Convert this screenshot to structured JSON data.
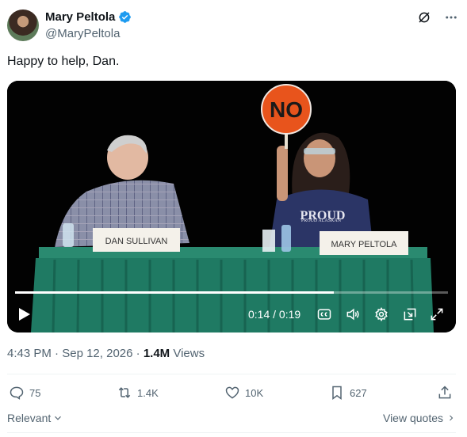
{
  "author": {
    "display_name": "Mary Peltola",
    "handle": "@MaryPeltola",
    "verified": true
  },
  "tweet": {
    "text": "Happy to help, Dan."
  },
  "video": {
    "sign_text": "NO",
    "nameplate_left": "DAN SULLIVAN",
    "nameplate_right": "MARY PELTOLA",
    "shirt_text": "PROUD ALASKAN",
    "time_display": "0:14 / 0:19",
    "progress_fraction": 0.737
  },
  "meta": {
    "time": "4:43 PM",
    "date": "Sep 12, 2026",
    "views_count": "1.4M",
    "views_label": "Views"
  },
  "actions": {
    "replies": "75",
    "reposts": "1.4K",
    "likes": "10K",
    "bookmarks": "627"
  },
  "footer": {
    "sort_label": "Relevant",
    "view_quotes_label": "View quotes"
  },
  "colors": {
    "verified_blue": "#1d9bf0",
    "text_secondary": "#536471",
    "table_green": "#1f7a63",
    "sign_orange": "#e8541c"
  }
}
